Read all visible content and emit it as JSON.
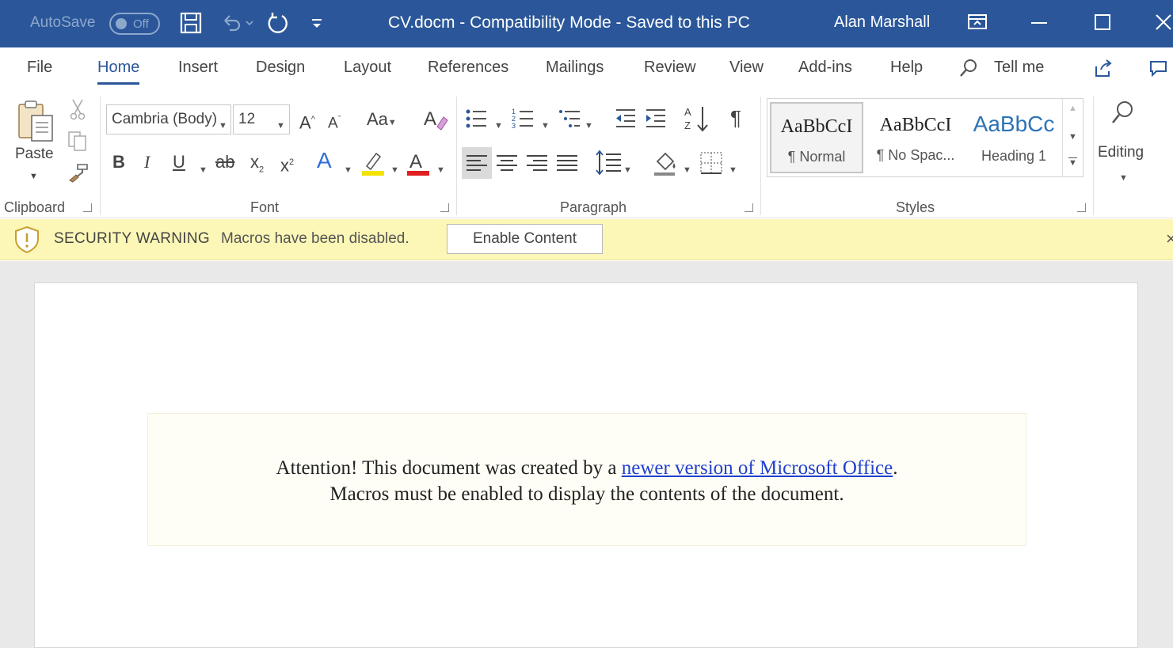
{
  "titlebar": {
    "autosave_label": "AutoSave",
    "autosave_state": "Off",
    "title": "CV.docm  -  Compatibility Mode  -  Saved to this PC",
    "user": "Alan Marshall",
    "icons": [
      "save-icon",
      "undo-icon",
      "redo-icon",
      "customize-icon",
      "ribbon-display-icon",
      "minimize-icon",
      "maximize-icon",
      "close-icon"
    ]
  },
  "tabs": [
    {
      "label": "File"
    },
    {
      "label": "Home",
      "active": true
    },
    {
      "label": "Insert"
    },
    {
      "label": "Design"
    },
    {
      "label": "Layout"
    },
    {
      "label": "References"
    },
    {
      "label": "Mailings"
    },
    {
      "label": "Review"
    },
    {
      "label": "View"
    },
    {
      "label": "Add-ins"
    },
    {
      "label": "Help"
    }
  ],
  "tell_me": "Tell me",
  "ribbon": {
    "clipboard": {
      "label": "Clipboard",
      "paste": "Paste"
    },
    "font": {
      "label": "Font",
      "font_name": "Cambria (Body)",
      "font_size": "12",
      "case_label": "Aa"
    },
    "paragraph": {
      "label": "Paragraph"
    },
    "styles": {
      "label": "Styles",
      "items": [
        {
          "preview": "AaBbCcI",
          "name": "¶ Normal"
        },
        {
          "preview": "AaBbCcI",
          "name": "¶ No Spac..."
        },
        {
          "preview": "AaBbCc",
          "name": "Heading 1"
        }
      ]
    },
    "editing": {
      "label": "Editing"
    }
  },
  "message_bar": {
    "title": "SECURITY WARNING",
    "text": "Macros have been disabled.",
    "button": "Enable Content"
  },
  "document": {
    "line1_before": "Attention! This document was created by a ",
    "line1_link": "newer version of Microsoft Office",
    "line1_after": ".",
    "line2": "Macros must be enabled to display the contents of the document."
  },
  "colors": {
    "titlebar": "#2b579a",
    "message_bar": "#fcf7b6",
    "link": "#1f3fd1"
  }
}
